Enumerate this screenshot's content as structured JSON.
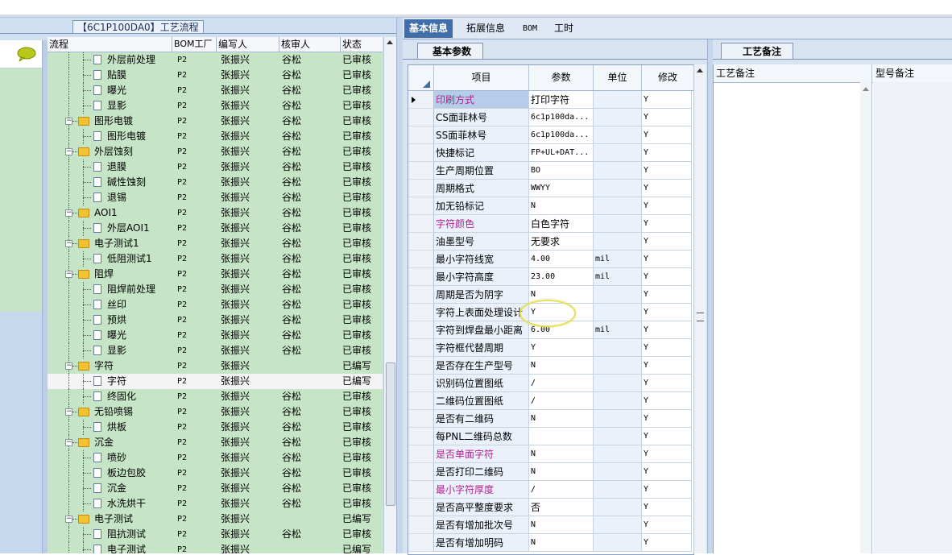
{
  "left_panel": {
    "title": "【6C1P100DA0】工艺流程",
    "columns": [
      "流程",
      "BOM工厂",
      "编写人",
      "核审人",
      "状态"
    ],
    "rows": [
      {
        "name": "外层前处理",
        "level": 2,
        "type": "doc",
        "bom": "P2",
        "writer": "张振兴",
        "reviewer": "谷松",
        "status": "已审核"
      },
      {
        "name": "贴膜",
        "level": 2,
        "type": "doc",
        "bom": "P2",
        "writer": "张振兴",
        "reviewer": "谷松",
        "status": "已审核"
      },
      {
        "name": "曝光",
        "level": 2,
        "type": "doc",
        "bom": "P2",
        "writer": "张振兴",
        "reviewer": "谷松",
        "status": "已审核"
      },
      {
        "name": "显影",
        "level": 2,
        "type": "doc",
        "bom": "P2",
        "writer": "张振兴",
        "reviewer": "谷松",
        "status": "已审核"
      },
      {
        "name": "图形电镀",
        "level": 1,
        "type": "folder",
        "bom": "P2",
        "writer": "张振兴",
        "reviewer": "谷松",
        "status": "已审核"
      },
      {
        "name": "图形电镀",
        "level": 2,
        "type": "doc",
        "bom": "P2",
        "writer": "张振兴",
        "reviewer": "谷松",
        "status": "已审核"
      },
      {
        "name": "外层蚀刻",
        "level": 1,
        "type": "folder",
        "bom": "P2",
        "writer": "张振兴",
        "reviewer": "谷松",
        "status": "已审核"
      },
      {
        "name": "退膜",
        "level": 2,
        "type": "doc",
        "bom": "P2",
        "writer": "张振兴",
        "reviewer": "谷松",
        "status": "已审核"
      },
      {
        "name": "碱性蚀刻",
        "level": 2,
        "type": "doc",
        "bom": "P2",
        "writer": "张振兴",
        "reviewer": "谷松",
        "status": "已审核"
      },
      {
        "name": "退锡",
        "level": 2,
        "type": "doc",
        "bom": "P2",
        "writer": "张振兴",
        "reviewer": "谷松",
        "status": "已审核"
      },
      {
        "name": "AOI1",
        "level": 1,
        "type": "folder",
        "bom": "P2",
        "writer": "张振兴",
        "reviewer": "谷松",
        "status": "已审核"
      },
      {
        "name": "外层AOI1",
        "level": 2,
        "type": "doc",
        "bom": "P2",
        "writer": "张振兴",
        "reviewer": "谷松",
        "status": "已审核"
      },
      {
        "name": "电子测试1",
        "level": 1,
        "type": "folder",
        "bom": "P2",
        "writer": "张振兴",
        "reviewer": "谷松",
        "status": "已审核"
      },
      {
        "name": "低阻测试1",
        "level": 2,
        "type": "doc",
        "bom": "P2",
        "writer": "张振兴",
        "reviewer": "谷松",
        "status": "已审核"
      },
      {
        "name": "阻焊",
        "level": 1,
        "type": "folder",
        "bom": "P2",
        "writer": "张振兴",
        "reviewer": "谷松",
        "status": "已审核"
      },
      {
        "name": "阻焊前处理",
        "level": 2,
        "type": "doc",
        "bom": "P2",
        "writer": "张振兴",
        "reviewer": "谷松",
        "status": "已审核"
      },
      {
        "name": "丝印",
        "level": 2,
        "type": "doc",
        "bom": "P2",
        "writer": "张振兴",
        "reviewer": "谷松",
        "status": "已审核"
      },
      {
        "name": "预烘",
        "level": 2,
        "type": "doc",
        "bom": "P2",
        "writer": "张振兴",
        "reviewer": "谷松",
        "status": "已审核"
      },
      {
        "name": "曝光",
        "level": 2,
        "type": "doc",
        "bom": "P2",
        "writer": "张振兴",
        "reviewer": "谷松",
        "status": "已审核"
      },
      {
        "name": "显影",
        "level": 2,
        "type": "doc",
        "bom": "P2",
        "writer": "张振兴",
        "reviewer": "谷松",
        "status": "已审核"
      },
      {
        "name": "字符",
        "level": 1,
        "type": "folder",
        "bom": "P2",
        "writer": "张振兴",
        "reviewer": "",
        "status": "已编写"
      },
      {
        "name": "字符",
        "level": 2,
        "type": "doc",
        "bom": "P2",
        "writer": "张振兴",
        "reviewer": "",
        "status": "已编写",
        "selected": true
      },
      {
        "name": "终固化",
        "level": 2,
        "type": "doc",
        "bom": "P2",
        "writer": "张振兴",
        "reviewer": "谷松",
        "status": "已审核"
      },
      {
        "name": "无铅喷锡",
        "level": 1,
        "type": "folder",
        "bom": "P2",
        "writer": "张振兴",
        "reviewer": "谷松",
        "status": "已审核"
      },
      {
        "name": "烘板",
        "level": 2,
        "type": "doc",
        "bom": "P2",
        "writer": "张振兴",
        "reviewer": "谷松",
        "status": "已审核"
      },
      {
        "name": "沉金",
        "level": 1,
        "type": "folder",
        "bom": "P2",
        "writer": "张振兴",
        "reviewer": "谷松",
        "status": "已审核"
      },
      {
        "name": "喷砂",
        "level": 2,
        "type": "doc",
        "bom": "P2",
        "writer": "张振兴",
        "reviewer": "谷松",
        "status": "已审核"
      },
      {
        "name": "板边包胶",
        "level": 2,
        "type": "doc",
        "bom": "P2",
        "writer": "张振兴",
        "reviewer": "谷松",
        "status": "已审核"
      },
      {
        "name": "沉金",
        "level": 2,
        "type": "doc",
        "bom": "P2",
        "writer": "张振兴",
        "reviewer": "谷松",
        "status": "已审核"
      },
      {
        "name": "水洗烘干",
        "level": 2,
        "type": "doc",
        "bom": "P2",
        "writer": "张振兴",
        "reviewer": "谷松",
        "status": "已审核"
      },
      {
        "name": "电子测试",
        "level": 1,
        "type": "folder",
        "bom": "P2",
        "writer": "张振兴",
        "reviewer": "",
        "status": "已编写"
      },
      {
        "name": "阻抗测试",
        "level": 2,
        "type": "doc",
        "bom": "P2",
        "writer": "张振兴",
        "reviewer": "谷松",
        "status": "已审核"
      },
      {
        "name": "电子测试",
        "level": 2,
        "type": "doc",
        "bom": "P2",
        "writer": "张振兴",
        "reviewer": "",
        "status": "已编写"
      }
    ]
  },
  "middle_tabs": [
    "基本信息",
    "拓展信息",
    "BOM",
    "工时"
  ],
  "basic_params": {
    "subtab": "基本参数",
    "columns": [
      "项目",
      "参数",
      "单位",
      "修改"
    ],
    "rows": [
      {
        "name": "印刷方式",
        "value": "打印字符",
        "unit": "",
        "mod": "Y",
        "pink": true,
        "selected": true
      },
      {
        "name": "CS面菲林号",
        "value": "6c1p100da...",
        "unit": "",
        "mod": "Y",
        "mono": true
      },
      {
        "name": "SS面菲林号",
        "value": "6c1p100da...",
        "unit": "",
        "mod": "Y",
        "mono": true
      },
      {
        "name": "快捷标记",
        "value": "FP+UL+DAT...",
        "unit": "",
        "mod": "Y",
        "mono": true
      },
      {
        "name": "生产周期位置",
        "value": "BO",
        "unit": "",
        "mod": "Y",
        "mono": true
      },
      {
        "name": "周期格式",
        "value": "WWYY",
        "unit": "",
        "mod": "Y",
        "mono": true
      },
      {
        "name": "加无铅标记",
        "value": "N",
        "unit": "",
        "mod": "Y",
        "mono": true
      },
      {
        "name": "字符颜色",
        "value": "白色字符",
        "unit": "",
        "mod": "Y",
        "pink": true
      },
      {
        "name": "油墨型号",
        "value": "无要求",
        "unit": "",
        "mod": "Y"
      },
      {
        "name": "最小字符线宽",
        "value": "4.00",
        "unit": "mil",
        "mod": "Y",
        "mono": true
      },
      {
        "name": "最小字符高度",
        "value": "23.00",
        "unit": "mil",
        "mod": "Y",
        "mono": true
      },
      {
        "name": "周期是否为阴字",
        "value": "N",
        "unit": "",
        "mod": "Y",
        "mono": true
      },
      {
        "name": "字符上表面处理设计",
        "value": "Y",
        "unit": "",
        "mod": "Y",
        "mono": true
      },
      {
        "name": "字符到焊盘最小距离",
        "value": "6.00",
        "unit": "mil",
        "mod": "Y",
        "mono": true
      },
      {
        "name": "字符框代替周期",
        "value": "Y",
        "unit": "",
        "mod": "Y",
        "mono": true
      },
      {
        "name": "是否存在生产型号",
        "value": "N",
        "unit": "",
        "mod": "Y",
        "mono": true
      },
      {
        "name": "识别码位置图纸",
        "value": "/",
        "unit": "",
        "mod": "Y",
        "mono": true
      },
      {
        "name": "二维码位置图纸",
        "value": "/",
        "unit": "",
        "mod": "Y",
        "mono": true
      },
      {
        "name": "是否有二维码",
        "value": "N",
        "unit": "",
        "mod": "Y",
        "mono": true
      },
      {
        "name": "每PNL二维码总数",
        "value": "",
        "unit": "",
        "mod": "Y"
      },
      {
        "name": "是否单面字符",
        "value": "N",
        "unit": "",
        "mod": "Y",
        "pink": true,
        "mono": true
      },
      {
        "name": "是否打印二维码",
        "value": "N",
        "unit": "",
        "mod": "Y",
        "mono": true
      },
      {
        "name": "最小字符厚度",
        "value": "/",
        "unit": "",
        "mod": "Y",
        "pink": true,
        "mono": true
      },
      {
        "name": "是否高平整度要求",
        "value": "否",
        "unit": "",
        "mod": "Y"
      },
      {
        "name": "是否有增加批次号",
        "value": "N",
        "unit": "",
        "mod": "Y",
        "mono": true
      },
      {
        "name": "是否有增加明码",
        "value": "N",
        "unit": "",
        "mod": "Y",
        "mono": true
      }
    ]
  },
  "process_notes": {
    "tab": "工艺备注",
    "columns": [
      "工艺备注",
      "型号备注"
    ]
  }
}
